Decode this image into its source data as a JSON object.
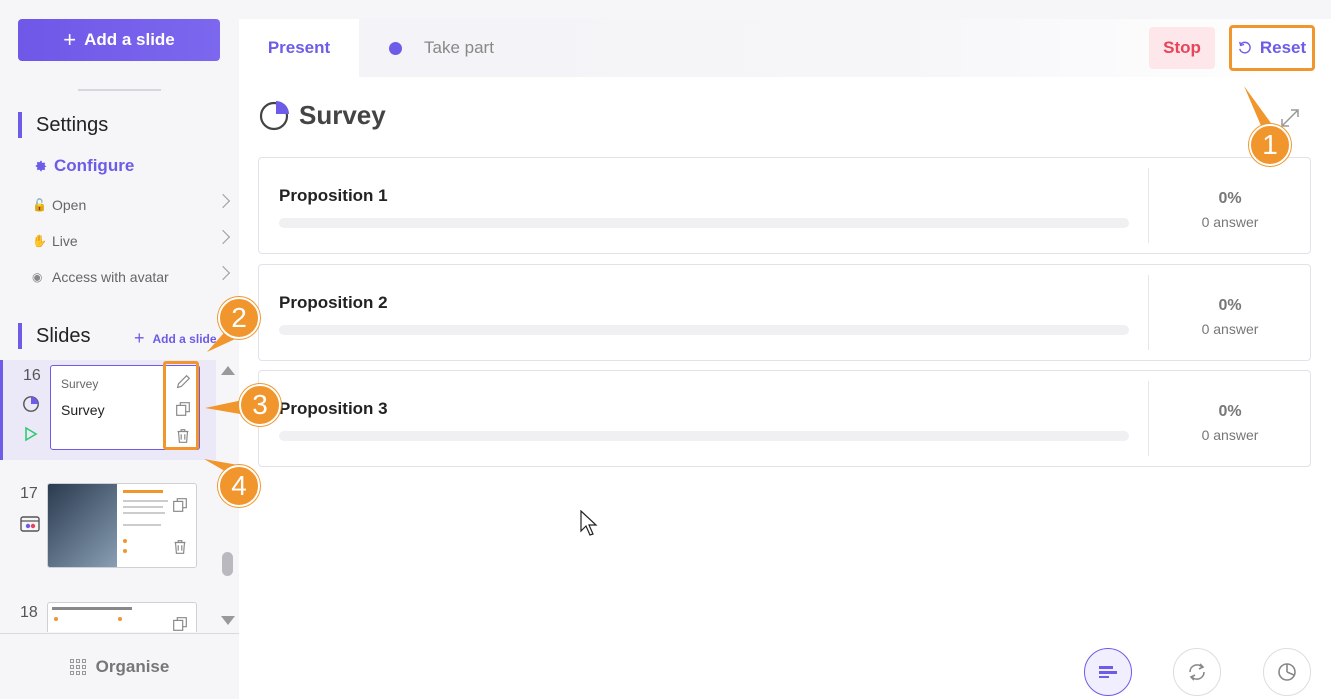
{
  "sidebar": {
    "add_slide_label": "Add a slide",
    "settings_title": "Settings",
    "configure_label": "Configure",
    "menu": [
      {
        "label": "Open",
        "icon": "unlock-icon"
      },
      {
        "label": "Live",
        "icon": "hand-icon"
      },
      {
        "label": "Access with avatar",
        "icon": "avatar-mask-icon"
      }
    ],
    "slides_title": "Slides",
    "add_slide_small": "Add a slide",
    "slides": [
      {
        "number": "16",
        "caption": "Survey",
        "title": "Survey"
      },
      {
        "number": "17",
        "caption": "",
        "title": ""
      },
      {
        "number": "18",
        "caption": "",
        "title": ""
      }
    ],
    "organise_label": "Organise"
  },
  "tabs": {
    "present": "Present",
    "take_part": "Take part"
  },
  "toolbar": {
    "stop": "Stop",
    "reset": "Reset"
  },
  "survey": {
    "title": "Survey",
    "propositions": [
      {
        "label": "Proposition 1",
        "percent": "0%",
        "answers": "0 answer",
        "fill": 0
      },
      {
        "label": "Proposition 2",
        "percent": "0%",
        "answers": "0 answer",
        "fill": 0
      },
      {
        "label": "Proposition 3",
        "percent": "0%",
        "answers": "0 answer",
        "fill": 0
      }
    ]
  },
  "callouts": [
    "1",
    "2",
    "3",
    "4"
  ],
  "colors": {
    "accent": "#6c5ce7",
    "callout": "#f0962c",
    "stop_text": "#e8445a",
    "stop_bg": "#fde7ea"
  }
}
